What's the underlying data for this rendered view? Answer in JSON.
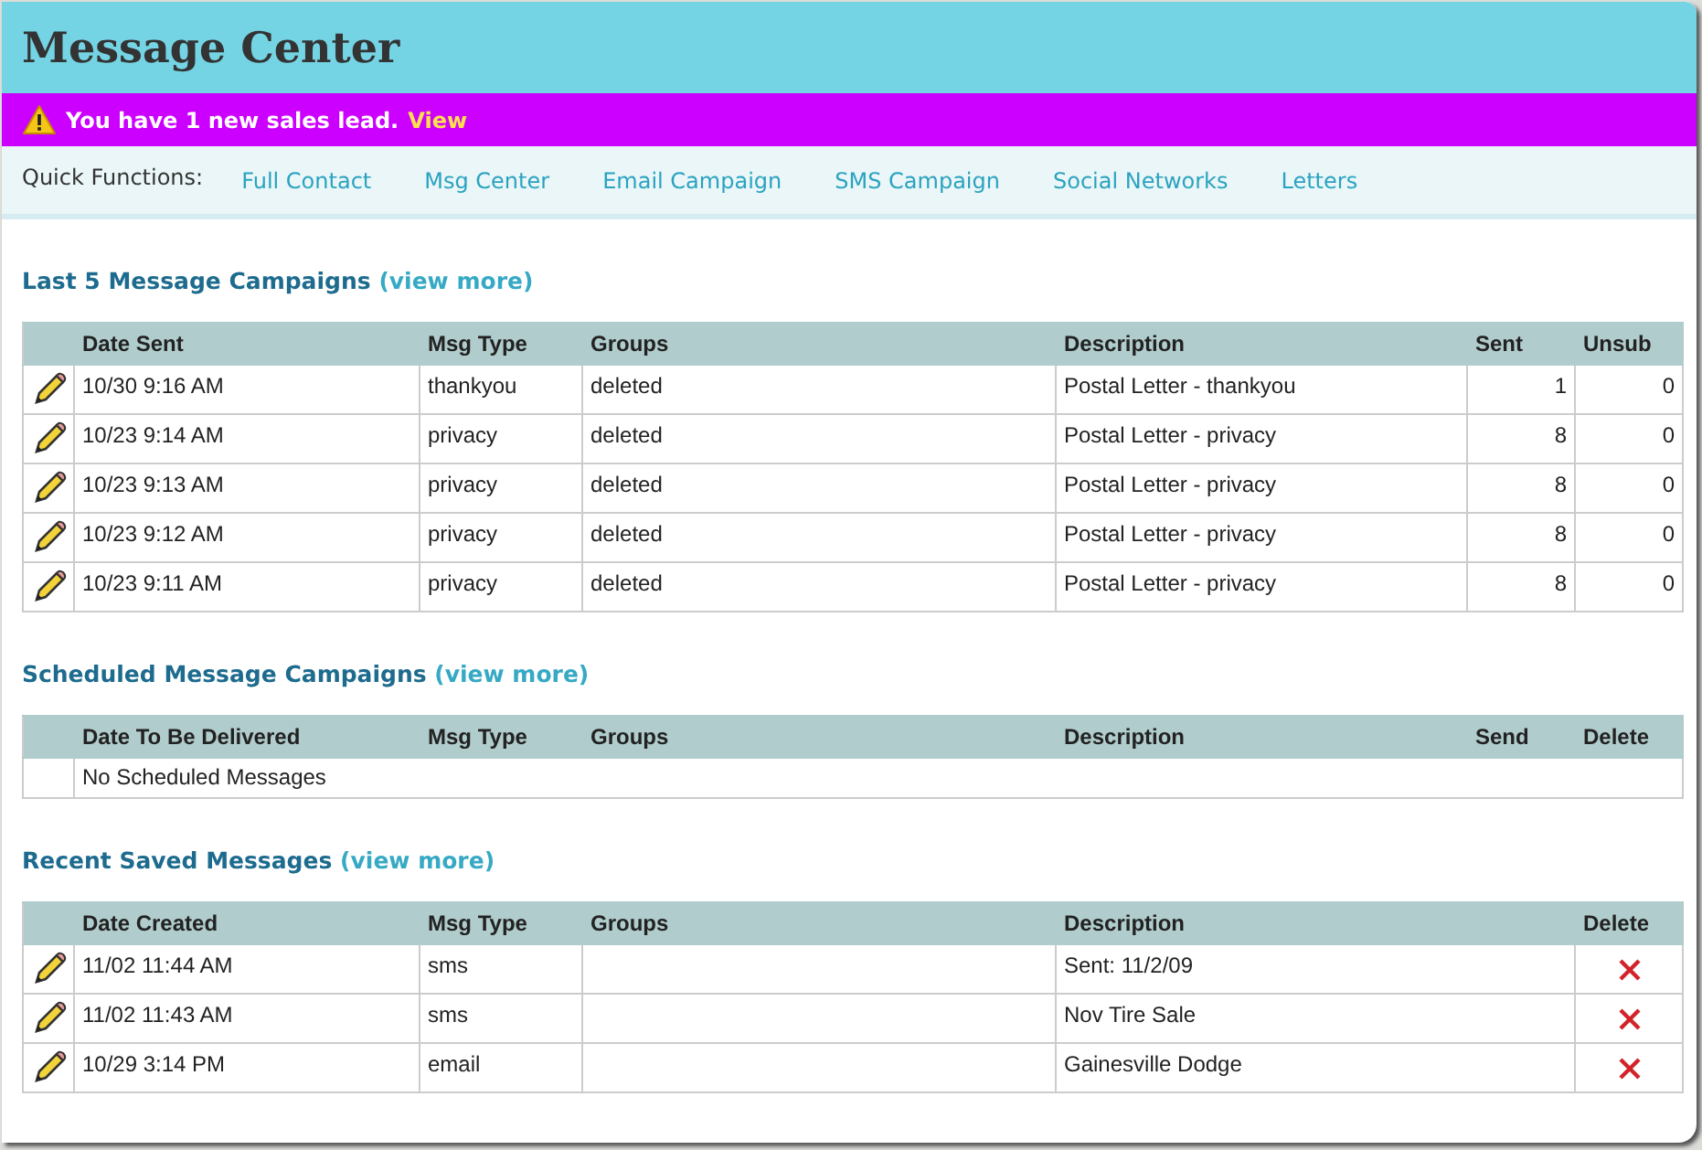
{
  "header": {
    "title": "Message Center"
  },
  "alert": {
    "message": "You have 1 new sales lead.",
    "link": "View"
  },
  "quick_functions": {
    "label": "Quick Functions:",
    "links": [
      "Full Contact",
      "Msg Center",
      "Email Campaign",
      "SMS Campaign",
      "Social Networks",
      "Letters"
    ]
  },
  "sections": [
    {
      "title": "Last 5 Message Campaigns",
      "link": "(view more)",
      "columns": [
        {
          "kind": "edit"
        },
        {
          "label": "Date Sent",
          "kind": "date"
        },
        {
          "label": "Msg Type",
          "kind": "type"
        },
        {
          "label": "Groups",
          "kind": "groups"
        },
        {
          "label": "Description",
          "kind": "desc"
        },
        {
          "label": "Sent",
          "kind": "num"
        },
        {
          "label": "Unsub",
          "kind": "num"
        }
      ],
      "rows": [
        {
          "cells": [
            "",
            "10/30 9:16 AM",
            "thankyou",
            "deleted",
            "Postal Letter - thankyou",
            "1",
            "0"
          ]
        },
        {
          "cells": [
            "",
            "10/23 9:14 AM",
            "privacy",
            "deleted",
            "Postal Letter - privacy",
            "8",
            "0"
          ]
        },
        {
          "cells": [
            "",
            "10/23 9:13 AM",
            "privacy",
            "deleted",
            "Postal Letter - privacy",
            "8",
            "0"
          ]
        },
        {
          "cells": [
            "",
            "10/23 9:12 AM",
            "privacy",
            "deleted",
            "Postal Letter - privacy",
            "8",
            "0"
          ]
        },
        {
          "cells": [
            "",
            "10/23 9:11 AM",
            "privacy",
            "deleted",
            "Postal Letter - privacy",
            "8",
            "0"
          ]
        }
      ]
    },
    {
      "title": "Scheduled Message Campaigns",
      "link": "(view more)",
      "columns": [
        {
          "kind": "blank"
        },
        {
          "label": "Date To Be Delivered",
          "kind": "date"
        },
        {
          "label": "Msg Type",
          "kind": "type"
        },
        {
          "label": "Groups",
          "kind": "groups"
        },
        {
          "label": "Description",
          "kind": "desc"
        },
        {
          "label": "Send",
          "kind": "num"
        },
        {
          "label": "Delete",
          "kind": "num"
        }
      ],
      "empty_message": "No Scheduled Messages"
    },
    {
      "title": "Recent Saved Messages",
      "link": "(view more)",
      "columns": [
        {
          "kind": "edit"
        },
        {
          "label": "Date Created",
          "kind": "date"
        },
        {
          "label": "Msg Type",
          "kind": "type"
        },
        {
          "label": "Groups",
          "kind": "groups"
        },
        {
          "label": "Description",
          "kind": "desc"
        },
        {
          "label": "Delete",
          "kind": "delete"
        }
      ],
      "rows": [
        {
          "cells": [
            "",
            "11/02 11:44 AM",
            "sms",
            "",
            "Sent: 11/2/09",
            ""
          ]
        },
        {
          "cells": [
            "",
            "11/02 11:43 AM",
            "sms",
            "",
            "Nov Tire Sale",
            ""
          ]
        },
        {
          "cells": [
            "",
            "10/29 3:14 PM",
            "email",
            "",
            "Gainesville Dodge",
            ""
          ]
        }
      ]
    }
  ]
}
